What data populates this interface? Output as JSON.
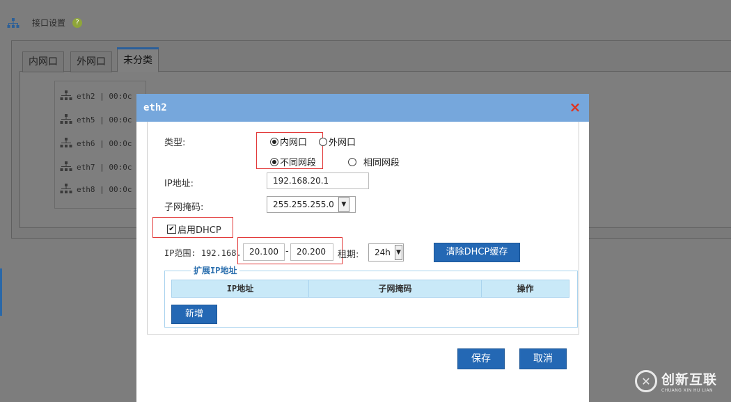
{
  "background": {
    "page_title": "接口设置",
    "help_glyph": "?",
    "tabs": [
      {
        "label": "内网口",
        "active": false
      },
      {
        "label": "外网口",
        "active": false
      },
      {
        "label": "未分类",
        "active": true
      }
    ],
    "interfaces": [
      {
        "text": "eth2 | 00:0c"
      },
      {
        "text": "eth5 | 00:0c"
      },
      {
        "text": "eth6 | 00:0c"
      },
      {
        "text": "eth7 | 00:0c"
      },
      {
        "text": "eth8 | 00:0c"
      }
    ]
  },
  "dialog": {
    "title": "eth2",
    "close_glyph": "×",
    "type_label": "类型:",
    "type_options": {
      "lan": "内网口",
      "wan": "外网口",
      "selected": "lan"
    },
    "segment_options": {
      "different": "不同网段",
      "same": "相同网段",
      "selected": "different"
    },
    "ip_label": "IP地址:",
    "ip_value": "192.168.20.1",
    "mask_label": "子网掩码:",
    "mask_value": "255.255.255.0",
    "dhcp_label": "启用DHCP",
    "dhcp_checked": true,
    "range_label": "IP范围: 192.168.",
    "range_start": "20.100",
    "range_sep": "-",
    "range_end": "20.200",
    "lease_label": "租期:",
    "lease_value": "24h",
    "clear_dhcp_button": "清除DHCP缓存",
    "ext_section_title": "扩展IP地址",
    "ext_table_headers": [
      "IP地址",
      "子网掩码",
      "操作"
    ],
    "add_button": "新增",
    "save_button": "保存",
    "cancel_button": "取消"
  },
  "watermark": {
    "brand": "创新互联",
    "brand_en": "CHUANG XIN HU LIAN"
  },
  "colors": {
    "dialog_header": "#76a7dc",
    "button_blue": "#2468b4",
    "close_red": "#e0321c",
    "highlight_red": "#e23a3a",
    "table_header": "#c9e9f8"
  }
}
